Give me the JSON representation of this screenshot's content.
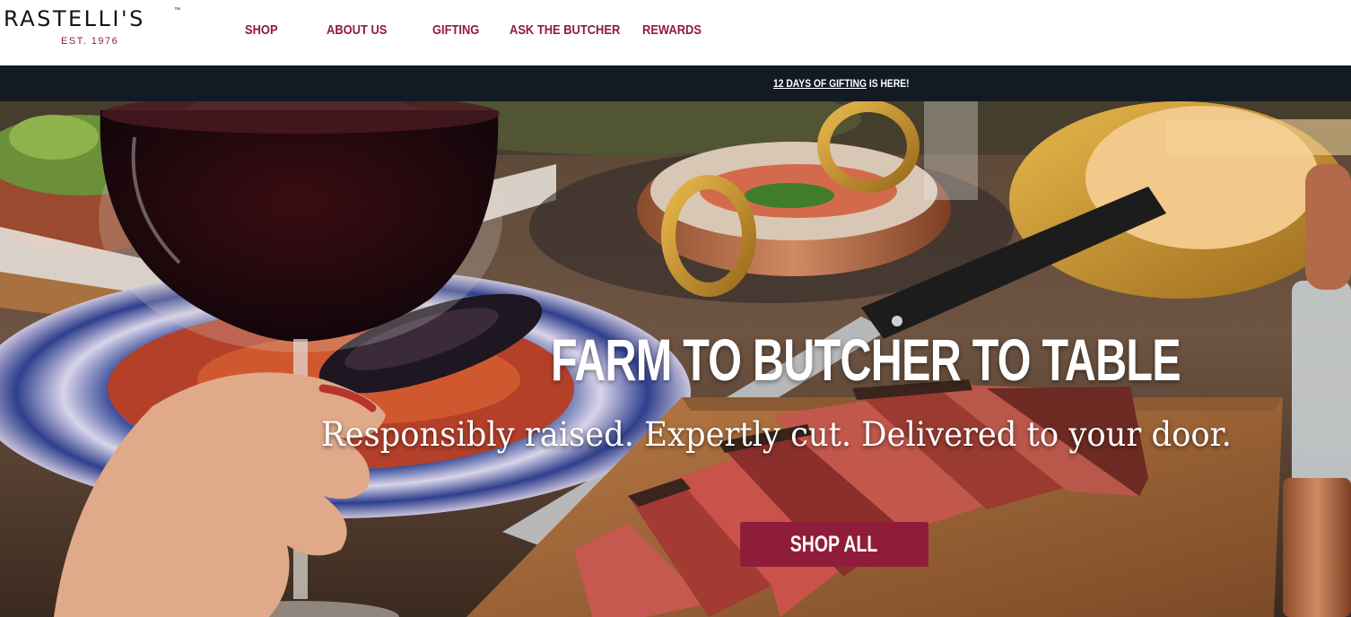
{
  "header": {
    "logo": {
      "name": "RASTELLI'S",
      "trademark": "™",
      "established": "EST. 1976"
    },
    "nav": [
      "SHOP",
      "ABOUT US",
      "GIFTING",
      "ASK THE BUTCHER",
      "REWARDS"
    ]
  },
  "announcement": {
    "link_text": "12 DAYS OF GIFTING",
    "suffix": " IS HERE!"
  },
  "hero": {
    "headline": "FARM TO BUTCHER TO TABLE",
    "subheadline": "Responsibly raised. Expertly cut. Delivered to your door.",
    "cta_label": "SHOP ALL",
    "image_description_icon": "steak-dinner-photo"
  },
  "colors": {
    "brand": "#8f1d3a",
    "announcement_bg": "#121a23",
    "text_dark": "#141414"
  }
}
